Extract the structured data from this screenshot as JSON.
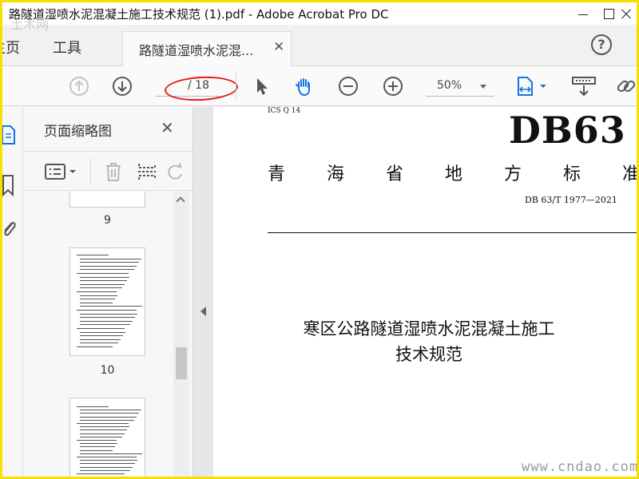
{
  "window": {
    "title": "路隧道湿喷水泥混凝土施工技术规范 (1).pdf - Adobe Acrobat Pro DC"
  },
  "menu": {
    "home_label": "主页",
    "tools_label": "工具",
    "doc_tab_label": "路隧道湿喷水泥混...",
    "help_label": "?"
  },
  "toolbar": {
    "page_total": "/ 18",
    "zoom_value": "50%"
  },
  "panel": {
    "title": "页面缩略图",
    "thumbnails": [
      {
        "page": "9"
      },
      {
        "page": "10"
      }
    ]
  },
  "document": {
    "ics": "ICS  Q  14",
    "standard_code": "DB63",
    "province": [
      "青",
      "海",
      "省",
      "地",
      "方",
      "标",
      "准"
    ],
    "standard_number": "DB 63/T  1977—2021",
    "title_line1": "寒区公路隧道湿喷水泥混凝土施工",
    "title_line2": "技术规范"
  },
  "watermarks": {
    "top_left": "土木网",
    "bottom_right": "www.cndao.com"
  },
  "colors": {
    "frame": "#f5e100",
    "annotation": "#e41a1a",
    "icon": "#555555",
    "accent_blue": "#1473e6"
  }
}
